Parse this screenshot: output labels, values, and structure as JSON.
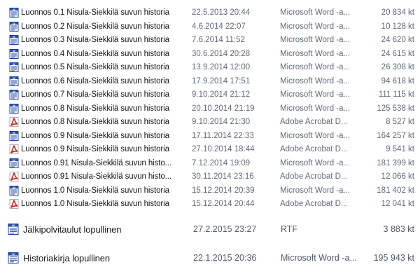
{
  "files": [
    {
      "name": "Luonnos 0.1 Nisula-Siekkilä suvun historia",
      "date": "22.5.2013 20:44",
      "type": "Microsoft Word -a...",
      "size": "20 834 kt",
      "icon": "word-doc-icon"
    },
    {
      "name": "Luonnos 0.2 Nisula-Siekkilä suvun historia",
      "date": "4.6.2014 22:07",
      "type": "Microsoft Word -a...",
      "size": "10 128 kt",
      "icon": "word-doc-icon"
    },
    {
      "name": "Luonnos 0.3 Nisula-Siekkilä suvun historia",
      "date": "7.6.2014 11:52",
      "type": "Microsoft Word -a...",
      "size": "24 620 kt",
      "icon": "word-doc-icon"
    },
    {
      "name": "Luonnos 0.4 Nisula-Siekkilä suvun historia",
      "date": "30.6.2014 20:28",
      "type": "Microsoft Word -a...",
      "size": "24 615 kt",
      "icon": "word-doc-icon"
    },
    {
      "name": "Luonnos 0.5 Nisula-Siekkilä suvun historia",
      "date": "13.9.2014 12:00",
      "type": "Microsoft Word -a...",
      "size": "26 308 kt",
      "icon": "word-doc-icon"
    },
    {
      "name": "Luonnos 0.6 Nisula-Siekkilä suvun historia",
      "date": "17.9.2014 17:51",
      "type": "Microsoft Word -a...",
      "size": "94 618 kt",
      "icon": "word-doc-icon"
    },
    {
      "name": "Luonnos 0.7  Nisula-Siekkilä suvun historia",
      "date": "9.10.2014 21:12",
      "type": "Microsoft Word -a...",
      "size": "111 115 kt",
      "icon": "word-doc-icon"
    },
    {
      "name": "Luonnos 0.8  Nisula-Siekkilä suvun historia",
      "date": "20.10.2014 21:19",
      "type": "Microsoft Word -a...",
      "size": "125 538 kt",
      "icon": "word-doc-icon"
    },
    {
      "name": "Luonnos 0.8  Nisula-Siekkilä suvun historia",
      "date": "9.10.2014 21:30",
      "type": "Adobe Acrobat D...",
      "size": "8 527 kt",
      "icon": "pdf-icon"
    },
    {
      "name": "Luonnos 0.9 Nisula-Siekkilä suvun historia",
      "date": "17.11.2014 22:33",
      "type": "Microsoft Word -a...",
      "size": "164 257 kt",
      "icon": "word-doc-icon"
    },
    {
      "name": "Luonnos 0.9 Nisula-Siekkilä suvun historia",
      "date": "27.10.2014 18:44",
      "type": "Adobe Acrobat D...",
      "size": "9 541 kt",
      "icon": "pdf-icon"
    },
    {
      "name": "Luonnos 0.91 Nisula-Siekkilä suvun histo...",
      "date": "7.12.2014 19:09",
      "type": "Microsoft Word -a...",
      "size": "181 399 kt",
      "icon": "word-doc-icon"
    },
    {
      "name": "Luonnos 0.91 Nisula-Siekkilä suvun histo...",
      "date": "30.11.2014 23:16",
      "type": "Adobe Acrobat D...",
      "size": "12 066 kt",
      "icon": "pdf-icon"
    },
    {
      "name": "Luonnos 1.0 Nisula-Siekkilä suvun historia",
      "date": "15.12.2014 20:39",
      "type": "Microsoft Word -a...",
      "size": "181 402 kt",
      "icon": "word-doc-icon"
    },
    {
      "name": "Luonnos 1.0 Nisula-Siekkilä suvun historia",
      "date": "15.12.2014 20:44",
      "type": "Adobe Acrobat D...",
      "size": "12 041 kt",
      "icon": "pdf-icon"
    },
    {
      "name": "Jälkipolvitaulut lopullinen",
      "date": "27.2.2015 23:27",
      "type": "RTF",
      "size": "3 883 kt",
      "icon": "rtf-doc-icon"
    },
    {
      "name": "Historiakirja lopullinen",
      "date": "22.1.2015 20:36",
      "type": "Microsoft Word -a...",
      "size": "195 943 kt",
      "icon": "word-doc-icon"
    }
  ],
  "colors": {
    "word_icon_blue": "#2a4fa8",
    "pdf_icon_red": "#c8201e",
    "name_text": "#16161a",
    "meta_text": "#5f6a78"
  }
}
